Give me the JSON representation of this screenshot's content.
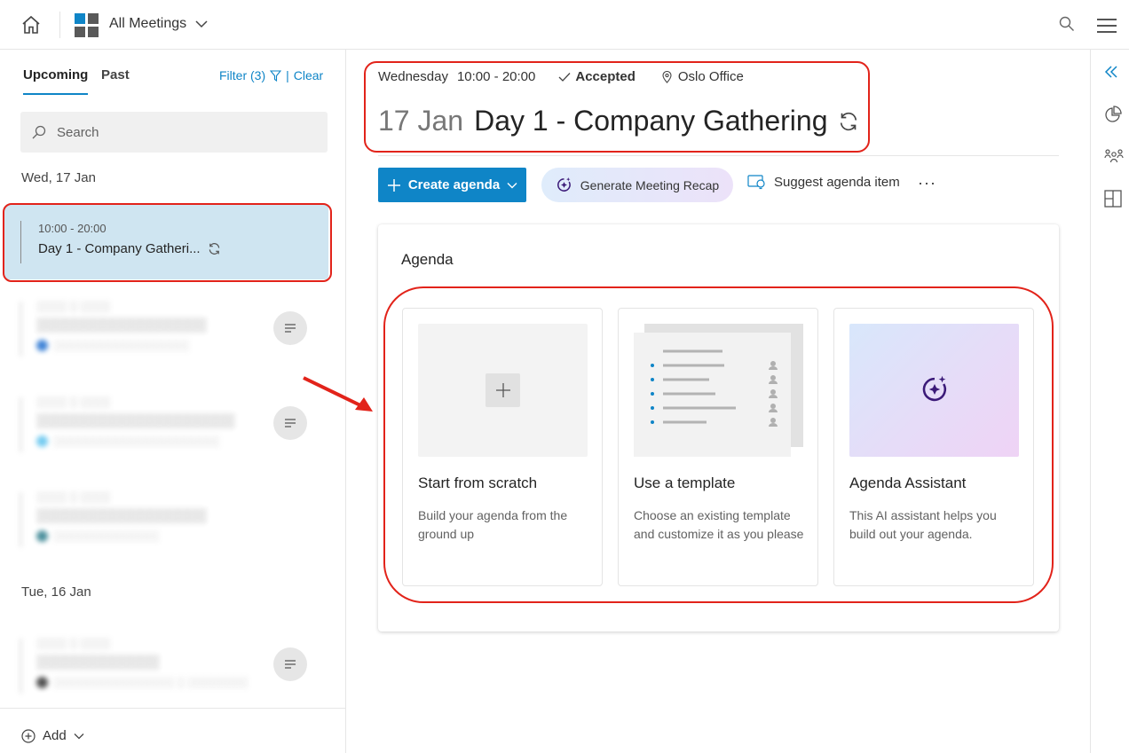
{
  "topbar": {
    "app_switch_label": "All Meetings"
  },
  "sidebar": {
    "tabs": [
      {
        "label": "Upcoming",
        "active": true
      },
      {
        "label": "Past",
        "active": false
      }
    ],
    "filter_label": "Filter (3)",
    "filter_separator": "|",
    "clear_label": "Clear",
    "search_placeholder": "Search",
    "groups": [
      {
        "date": "Wed, 17 Jan",
        "meetings": [
          {
            "time": "10:00 - 20:00",
            "title": "Day 1 - Company Gatheri...",
            "selected": true
          }
        ]
      },
      {
        "date": "Tue, 16 Jan"
      }
    ],
    "add_label": "Add"
  },
  "meeting": {
    "day": "Wednesday",
    "time": "10:00 - 20:00",
    "status": "Accepted",
    "location": "Oslo Office",
    "date_label": "17 Jan",
    "title": "Day 1 - Company Gathering"
  },
  "toolbar": {
    "create_agenda_label": "Create agenda",
    "generate_recap_label": "Generate Meeting Recap",
    "suggest_label": "Suggest agenda item",
    "more_label": "···"
  },
  "agenda": {
    "heading": "Agenda",
    "cards": [
      {
        "title": "Start from scratch",
        "desc": "Build your agenda from the ground up"
      },
      {
        "title": "Use a template",
        "desc": "Choose an existing template and customize it as you please"
      },
      {
        "title": "Agenda Assistant",
        "desc": "This AI assistant helps you build out your agenda."
      }
    ]
  },
  "colors": {
    "accent": "#0f85c7",
    "selected_bg": "#cfe5f1",
    "highlight": "#e2231a",
    "ai_purple": "#3b1a78"
  },
  "icons": [
    "home-icon",
    "apps-icon",
    "chevron-down-icon",
    "search-icon",
    "hamburger-menu-icon",
    "filter-icon",
    "sync-icon",
    "note-icon",
    "add-circle-icon",
    "check-icon",
    "location-pin-icon",
    "plus-icon",
    "sparkle-icon",
    "lightbulb-icon",
    "collapse-icon",
    "pie-chart-icon",
    "people-icon",
    "layout-icon"
  ]
}
